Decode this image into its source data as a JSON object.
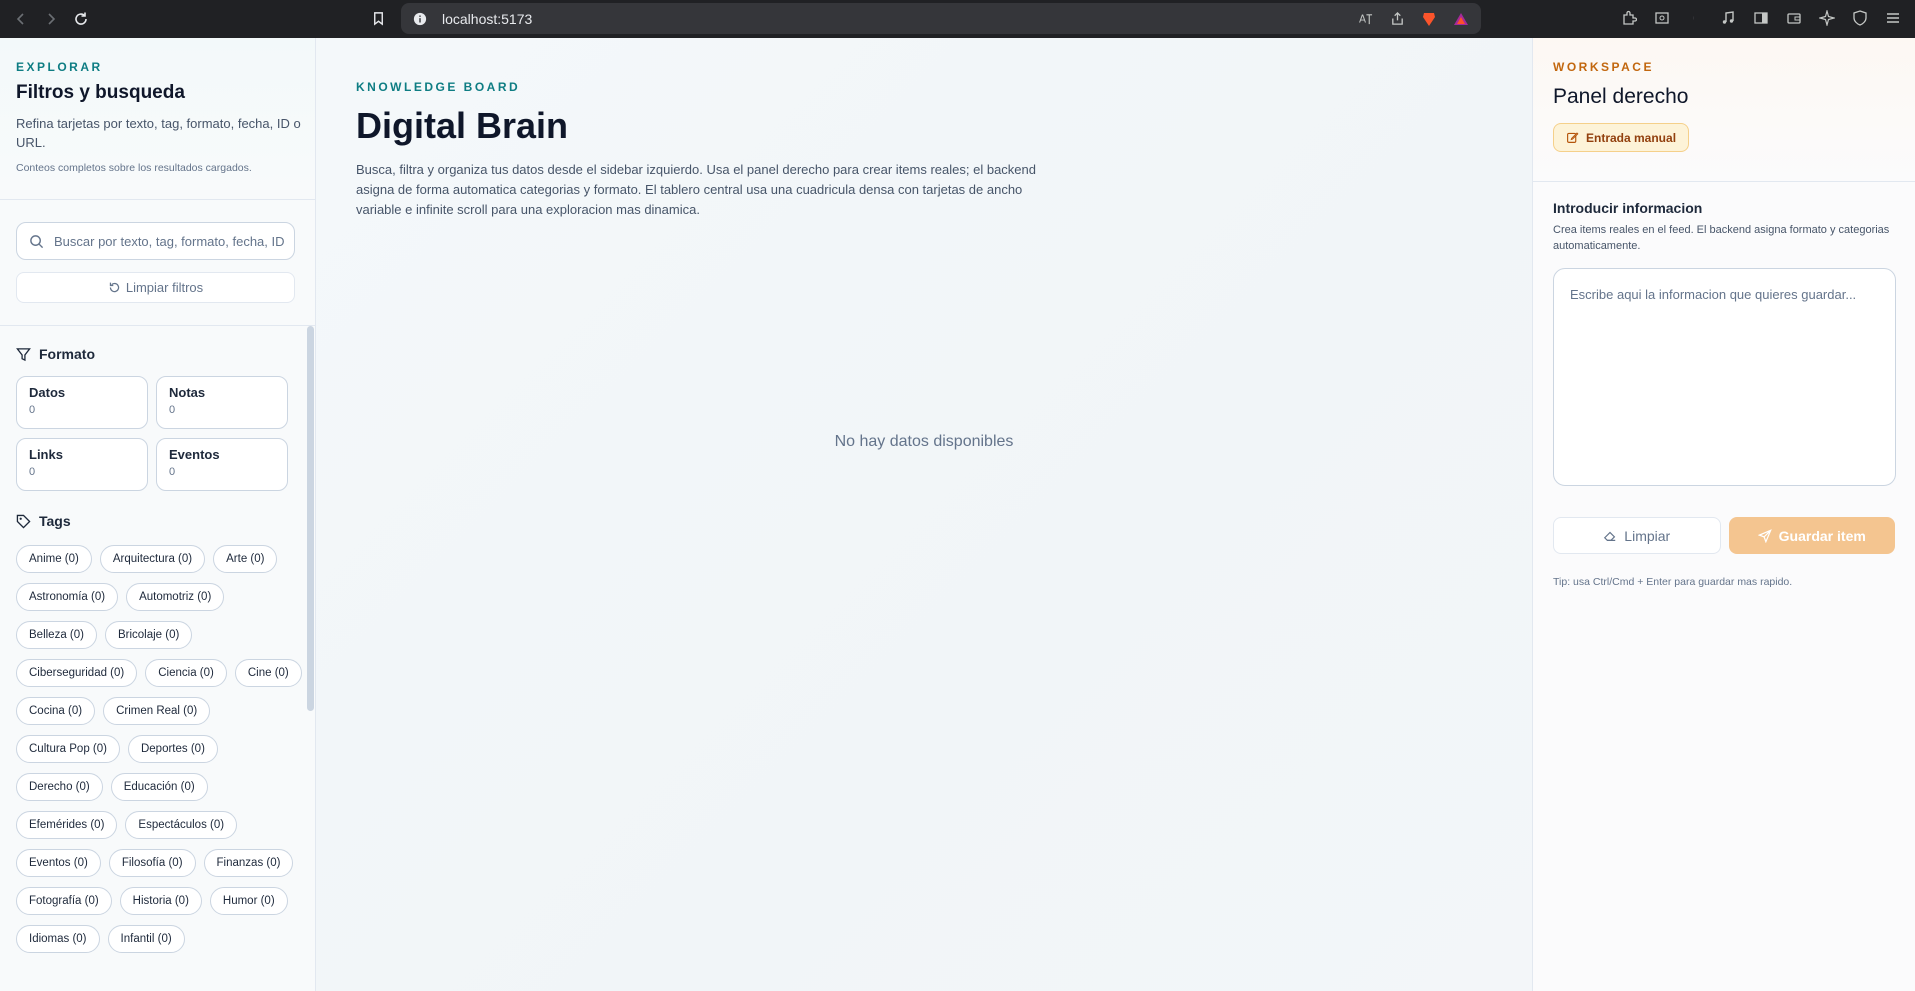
{
  "browser": {
    "url": "localhost:5173"
  },
  "left": {
    "eyebrow": "EXPLORAR",
    "title": "Filtros y busqueda",
    "description": "Refina tarjetas por texto, tag, formato, fecha, ID o URL.",
    "note": "Conteos completos sobre los resultados cargados.",
    "search_placeholder": "Buscar por texto, tag, formato, fecha, ID o URL",
    "clear_label": "Limpiar filtros",
    "format_title": "Formato",
    "formats": [
      {
        "name": "Datos",
        "count": "0"
      },
      {
        "name": "Notas",
        "count": "0"
      },
      {
        "name": "Links",
        "count": "0"
      },
      {
        "name": "Eventos",
        "count": "0"
      }
    ],
    "tags_title": "Tags",
    "tags": [
      "Anime (0)",
      "Arquitectura (0)",
      "Arte (0)",
      "Astronomía (0)",
      "Automotriz (0)",
      "Belleza (0)",
      "Bricolaje (0)",
      "Ciberseguridad (0)",
      "Ciencia (0)",
      "Cine (0)",
      "Cocina (0)",
      "Crimen Real (0)",
      "Cultura Pop (0)",
      "Deportes (0)",
      "Derecho (0)",
      "Educación (0)",
      "Efemérides (0)",
      "Espectáculos (0)",
      "Eventos (0)",
      "Filosofía (0)",
      "Finanzas (0)",
      "Fotografía (0)",
      "Historia (0)",
      "Humor (0)",
      "Idiomas (0)",
      "Infantil (0)"
    ]
  },
  "main": {
    "eyebrow": "KNOWLEDGE BOARD",
    "title": "Digital Brain",
    "description": "Busca, filtra y organiza tus datos desde el sidebar izquierdo. Usa el panel derecho para crear items reales; el backend asigna de forma automatica categorias y formato. El tablero central usa una cuadricula densa con tarjetas de ancho variable e infinite scroll para una exploracion mas dinamica.",
    "empty": "No hay datos disponibles"
  },
  "right": {
    "eyebrow": "WORKSPACE",
    "title": "Panel derecho",
    "badge": "Entrada manual",
    "heading": "Introducir informacion",
    "subtext": "Crea items reales en el feed. El backend asigna formato y categorias automaticamente.",
    "textarea_placeholder": "Escribe aqui la informacion que quieres guardar...",
    "clear_label": "Limpiar",
    "save_label": "Guardar item",
    "tip": "Tip: usa Ctrl/Cmd + Enter para guardar mas rapido."
  },
  "colors": {
    "accent_teal": "#0e7d83",
    "accent_orange": "#c2670f",
    "save_button": "#f4c590"
  }
}
